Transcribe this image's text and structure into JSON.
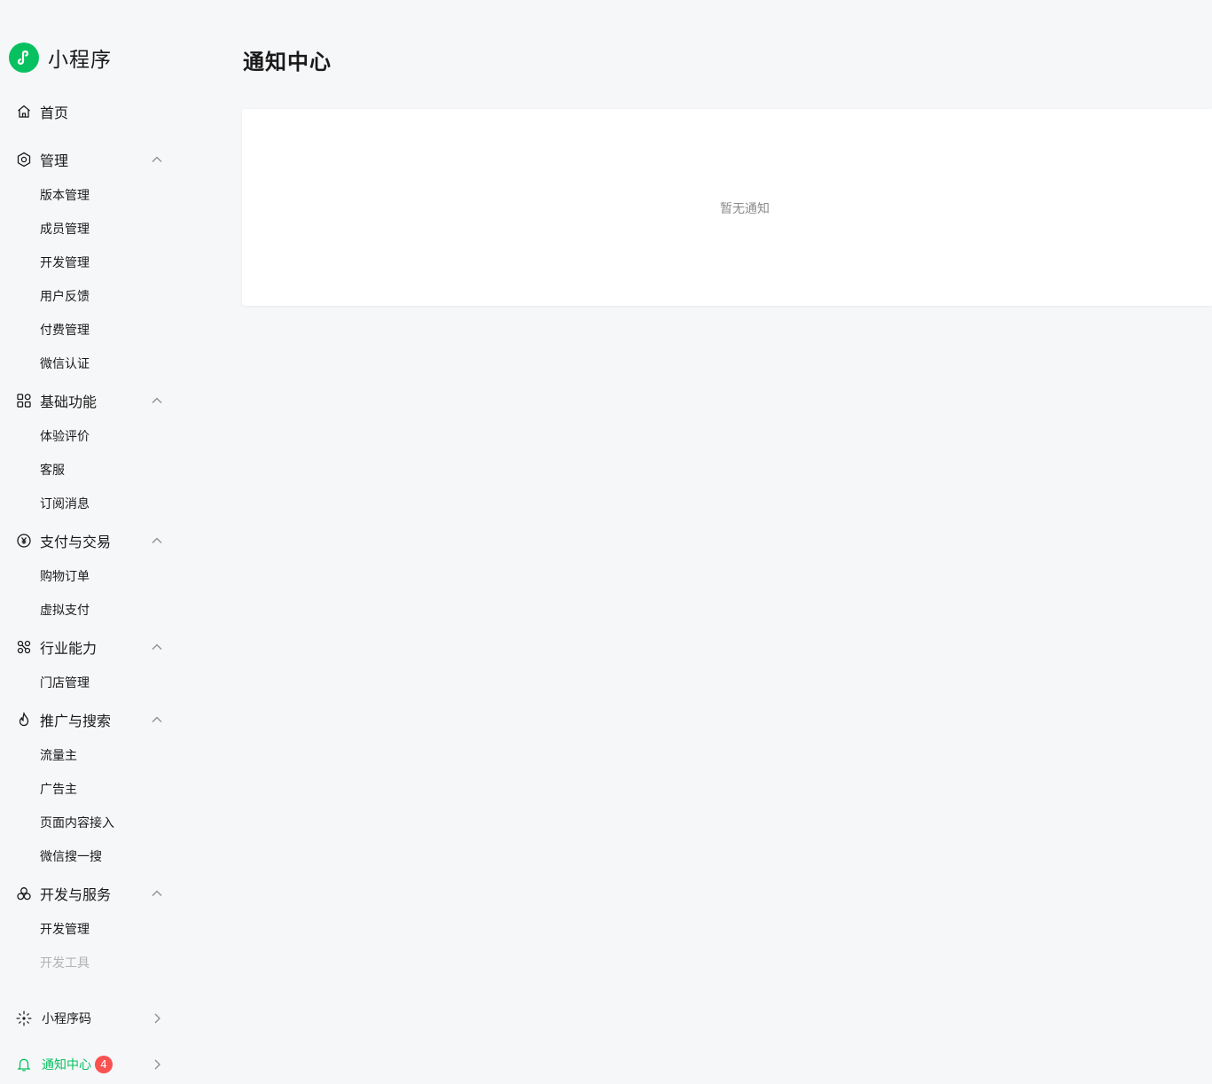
{
  "brand": {
    "name": "小程序",
    "color": "#07c160"
  },
  "nav": {
    "home": "首页",
    "manage": {
      "label": "管理",
      "items": [
        "版本管理",
        "成员管理",
        "开发管理",
        "用户反馈",
        "付费管理",
        "微信认证"
      ]
    },
    "basic": {
      "label": "基础功能",
      "items": [
        "体验评价",
        "客服",
        "订阅消息"
      ]
    },
    "pay": {
      "label": "支付与交易",
      "items": [
        "购物订单",
        "虚拟支付"
      ]
    },
    "industry": {
      "label": "行业能力",
      "items": [
        "门店管理"
      ]
    },
    "promo": {
      "label": "推广与搜索",
      "items": [
        "流量主",
        "广告主",
        "页面内容接入",
        "微信搜一搜"
      ]
    },
    "dev": {
      "label": "开发与服务",
      "items": [
        "开发管理",
        "开发工具"
      ]
    }
  },
  "bottom": {
    "qrcode": "小程序码",
    "notify": {
      "label": "通知中心",
      "badge": "4"
    }
  },
  "main": {
    "title": "通知中心",
    "empty": "暂无通知"
  }
}
